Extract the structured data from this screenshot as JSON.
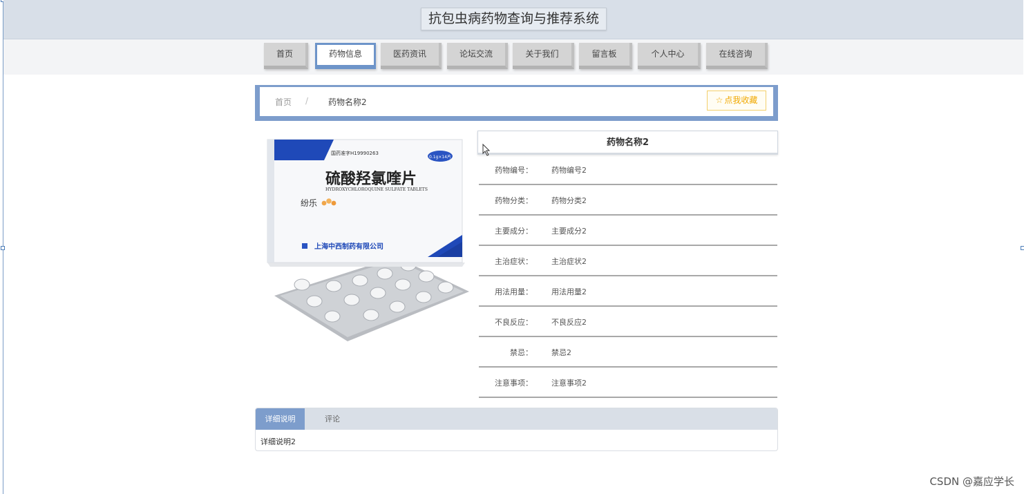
{
  "header": {
    "title": "抗包虫病药物查询与推荐系统"
  },
  "nav": {
    "items": [
      {
        "label": "首页",
        "active": false
      },
      {
        "label": "药物信息",
        "active": true
      },
      {
        "label": "医药资讯",
        "active": false
      },
      {
        "label": "论坛交流",
        "active": false
      },
      {
        "label": "关于我们",
        "active": false
      },
      {
        "label": "留言板",
        "active": false
      },
      {
        "label": "个人中心",
        "active": false
      },
      {
        "label": "在线咨询",
        "active": false
      }
    ]
  },
  "breadcrumb": {
    "home": "首页",
    "separator": "/",
    "current": "药物名称2"
  },
  "favorite_button": {
    "icon": "star-icon",
    "label": "点我收藏"
  },
  "product_image": {
    "approval": "国药准字H19990263",
    "spec": "0.1g×14片",
    "name_cn": "硫酸羟氯喹片",
    "name_en": "HYDROXYCHLOROQUINE SULFATE TABLETS",
    "brand": "纷乐",
    "maker": "上海中西制药有限公司"
  },
  "detail": {
    "title": "药物名称2",
    "rows": [
      {
        "label": "药物编号：",
        "value": "药物编号2"
      },
      {
        "label": "药物分类：",
        "value": "药物分类2"
      },
      {
        "label": "主要成分：",
        "value": "主要成分2"
      },
      {
        "label": "主治症状：",
        "value": "主治症状2"
      },
      {
        "label": "用法用量：",
        "value": "用法用量2"
      },
      {
        "label": "不良反应：",
        "value": "不良反应2"
      },
      {
        "label": "禁忌：",
        "value": "禁忌2"
      },
      {
        "label": "注意事项：",
        "value": "注意事项2"
      }
    ]
  },
  "tabs": {
    "items": [
      {
        "label": "详细说明"
      },
      {
        "label": "评论"
      }
    ],
    "content": "详细说明2"
  },
  "watermark": "CSDN @嘉应学长",
  "colors": {
    "accent": "#7d9dcc",
    "header_bg": "#d8dfe8",
    "favorite": "#f0a800"
  }
}
